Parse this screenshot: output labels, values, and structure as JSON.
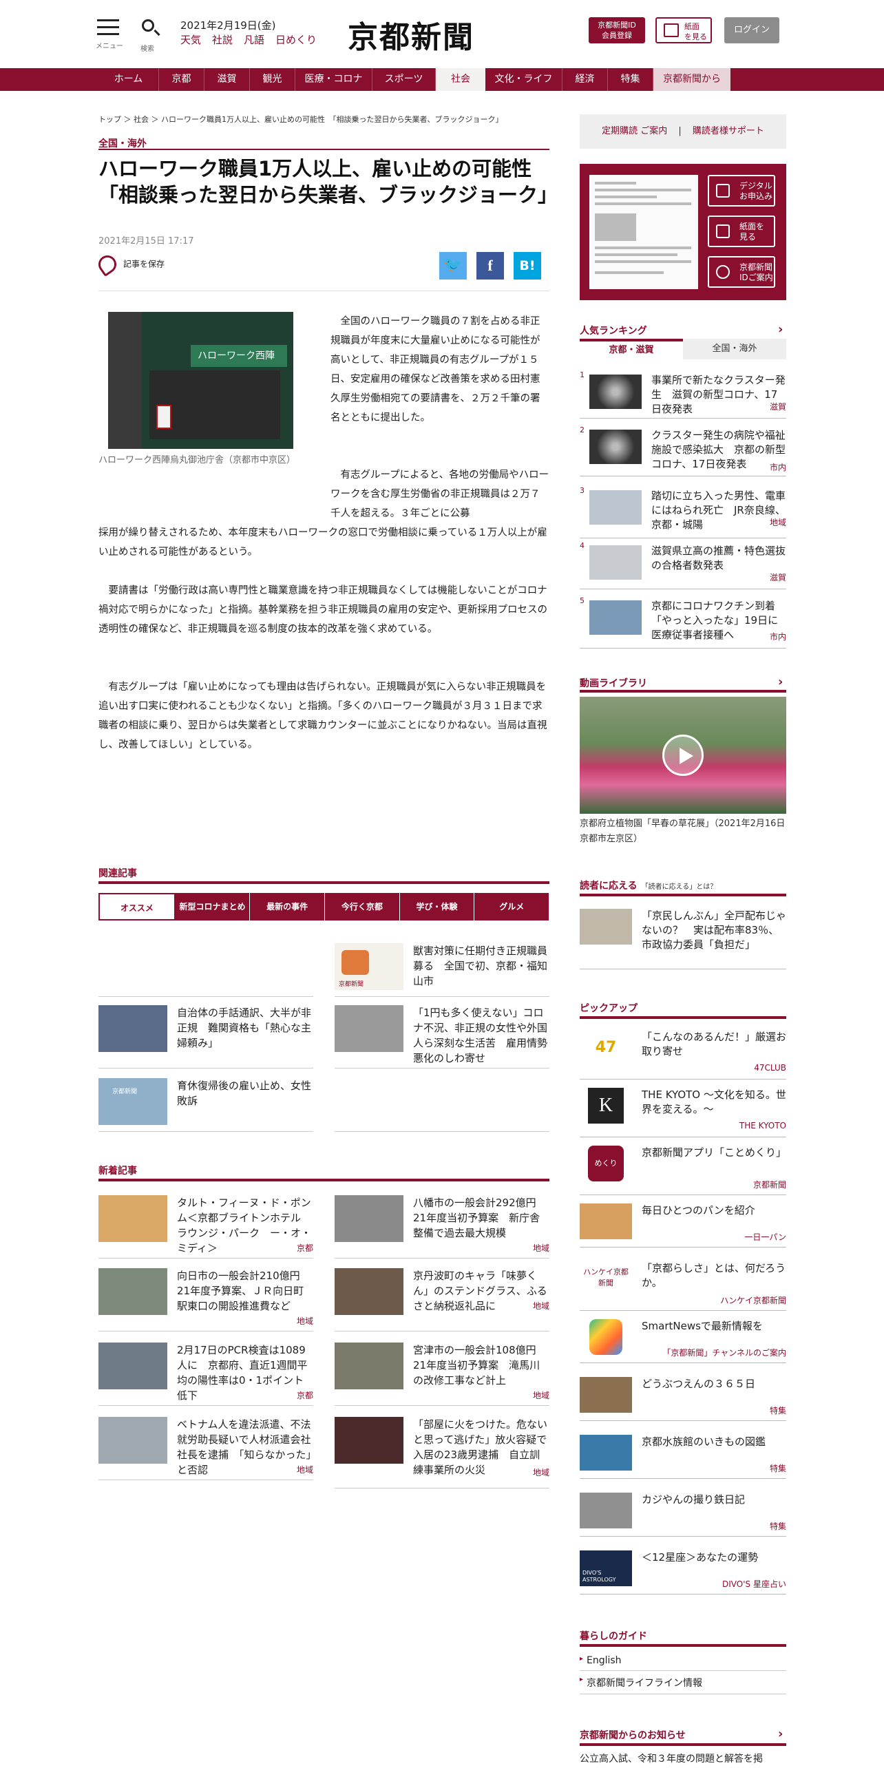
{
  "header": {
    "menu_label": "メニュー",
    "search_label": "検索",
    "date": "2021年2月19日(金)",
    "links": [
      "天気",
      "社説",
      "凡語",
      "日めくり"
    ],
    "logo": "京都新聞",
    "id_button": [
      "京都新聞ID",
      "会員登録"
    ],
    "paper_button": [
      "紙面",
      "を見る"
    ],
    "login_button": "ログイン"
  },
  "nav": [
    "ホーム",
    "京都",
    "滋賀",
    "観光",
    "医療・コロナ",
    "スポーツ",
    "社会",
    "文化・ライフ",
    "経済",
    "特集",
    "京都新聞から"
  ],
  "article": {
    "breadcrumb": "トップ ＞ 社会 ＞ ハローワーク職員1万人以上、雇い止めの可能性　「相談乗った翌日から失業者、ブラックジョーク」",
    "category": "全国・海外",
    "title": "ハローワーク職員1万人以上、雇い止めの可能性　「相談乗った翌日から失業者、ブラックジョーク」",
    "date": "2021年2月15日 17:17",
    "save_label": "記事を保存",
    "photo_sign": "ハローワーク西陣",
    "caption": "ハローワーク西陣烏丸御池庁舎（京都市中京区）",
    "p1": "全国のハローワーク職員の７割を占める非正規職員が年度末に大量雇い止めになる可能性が高いとして、非正規職員の有志グループが１５日、安定雇用の確保など改善策を求める田村憲久厚生労働相宛ての要請書を、２万２千筆の署名とともに提出した。",
    "p2a": "有志グループによると、各地の労働局やハローワークを含む厚生労働省の非正規職員は２万７千人を超える。３年ごとに公募",
    "p2b": "採用が繰り替えされるため、本年度末もハローワークの窓口で労働相談に乗っている１万人以上が雇い止めされる可能性があるという。",
    "p3": "要請書は「労働行政は高い専門性と職業意識を持つ非正規職員なくしては機能しないことがコロナ禍対応で明らかになった」と指摘。基幹業務を担う非正規職員の雇用の安定や、更新採用プロセスの透明性の確保など、非正規職員を巡る制度の抜本的改革を強く求めている。",
    "p4": "有志グループは「雇い止めになっても理由は告げられない。正規職員が気に入らない非正規職員を追い出す口実に使われることも少なくない」と指摘。「多くのハローワーク職員が３月３１日まで求職者の相談に乗り、翌日からは失業者として求職カウンターに並ぶことになりかねない。当局は直視し、改善してほしい」としている。"
  },
  "related": {
    "heading": "関連記事",
    "tabs": [
      "オススメ",
      "新型コロナまとめ",
      "最新の事件",
      "今行く京都",
      "学び・体験",
      "グルメ"
    ],
    "items": [
      {
        "title": "獣害対策に任期付き正規職員募る　全国で初、京都・福知山市"
      },
      {
        "title": "自治体の手話通訳、大半が非正規　難関資格も「熱心な主婦頼み」"
      },
      {
        "title": "「1円も多く使えない」コロナ不況、非正規の女性や外国人ら深刻な生活苦　雇用情勢悪化のしわ寄せ"
      },
      {
        "title": "育休復帰後の雇い止め、女性敗訴"
      }
    ],
    "thumb_label": "京都新聞"
  },
  "latest": {
    "heading": "新着記事",
    "items": [
      {
        "title": "タルト・フィーヌ・ド・ポンム＜京都ブライトンホテル　ラウンジ・パーク　ー・オ・ミディ＞",
        "tag": "京都"
      },
      {
        "title": "八幡市の一般会計292億円　21年度当初予算案　新庁舎整備で過去最大規模",
        "tag": "地域"
      },
      {
        "title": "向日市の一般会計210億円　21年度予算案、ＪＲ向日町駅東口の開設推進費など",
        "tag": "地域"
      },
      {
        "title": "京丹波町のキャラ「味夢くん」のステンドグラス、ふるさと納税返礼品に",
        "tag": "地域"
      },
      {
        "title": "2月17日のPCR検査は1089人に　京都府、直近1週間平均の陽性率は0・1ポイント低下",
        "tag": "京都"
      },
      {
        "title": "宮津市の一般会計108億円　21年度当初予算案　滝馬川の改修工事など計上",
        "tag": "地域"
      },
      {
        "title": "ベトナム人を違法派遣、不法就労助長疑いで人材派遣会社社長を逮捕　「知らなかった」と否認",
        "tag": "地域"
      },
      {
        "title": "「部屋に火をつけた。危ないと思って逃げた」放火容疑で入居の23歳男逮捕　自立訓練事業所の火災",
        "tag": "地域"
      }
    ]
  },
  "sidebar": {
    "subscribe": [
      "定期購読 ご案内",
      "|",
      "購読者様サポート"
    ],
    "paper_buttons": [
      [
        "デジタル",
        "お申込み"
      ],
      [
        "紙面を",
        "見る"
      ],
      [
        "京都新聞",
        "IDご案内"
      ]
    ],
    "ranking": {
      "heading": "人気ランキング",
      "tabs": [
        "京都・滋賀",
        "全国・海外"
      ],
      "items": [
        {
          "n": "1",
          "title": "事業所で新たなクラスター発生　滋賀の新型コロナ、17日夜発表",
          "tag": "滋賀"
        },
        {
          "n": "2",
          "title": "クラスター発生の病院や福祉施設で感染拡大　京都の新型コロナ、17日夜発表",
          "tag": "市内"
        },
        {
          "n": "3",
          "title": "踏切に立ち入った男性、電車にはねられ死亡　JR奈良線、京都・城陽",
          "tag": "地域"
        },
        {
          "n": "4",
          "title": "滋賀県立高の推薦・特色選抜の合格者数発表",
          "tag": "滋賀"
        },
        {
          "n": "5",
          "title": "京都にコロナワクチン到着　「やっと入ったな」19日に医療従事者接種へ",
          "tag": "市内"
        }
      ]
    },
    "video": {
      "heading": "動画ライブラリ",
      "caption": "京都府立植物園「早春の草花展」（2021年2月16日　京都市左京区）"
    },
    "readers": {
      "heading": "読者に応える",
      "sub": "「読者に応える」とは？",
      "title": "「京民しんぶん」全戸配布じゃないの？　実は配布率83％、市政協力委員「負担だ」"
    },
    "pickup": {
      "heading": "ピックアップ",
      "items": [
        {
          "title": "「こんなのあるんだ！」厳選お取り寄せ",
          "tag": "47CLUB",
          "thumb": "47"
        },
        {
          "title": "THE KYOTO ～文化を知る。世界を変える。～",
          "tag": "THE KYOTO",
          "thumb": "K"
        },
        {
          "title": "京都新聞アプリ「ことめくり」",
          "tag": "京都新聞",
          "thumb": "めくり"
        },
        {
          "title": "毎日ひとつのパンを紹介",
          "tag": "一日一パン",
          "thumb": ""
        },
        {
          "title": "「京都らしさ」とは、何だろうか。",
          "tag": "ハンケイ京都新聞",
          "thumb": "ハンケイ京都新聞"
        },
        {
          "title": "SmartNewsで最新情報を",
          "tag": "「京都新聞」チャンネルのご案内",
          "thumb": ""
        },
        {
          "title": "どうぶつえんの３６５日",
          "tag": "特集",
          "thumb": ""
        },
        {
          "title": "京都水族館のいきもの図鑑",
          "tag": "特集",
          "thumb": ""
        },
        {
          "title": "カジやんの撮り鉄日記",
          "tag": "特集",
          "thumb": ""
        },
        {
          "title": "＜12星座＞あなたの運勢",
          "tag": "DIVO'S 星座占い",
          "thumb": "DIVO'S ASTROLOGY"
        }
      ]
    },
    "guide": {
      "heading": "暮らしのガイド",
      "items": [
        "English",
        "京都新聞ライフライン情報"
      ]
    },
    "notice": {
      "heading": "京都新聞からのお知らせ",
      "item": "公立高入試、令和３年度の問題と解答を掲"
    }
  },
  "colors": {
    "brand": "#8a0e2e",
    "twitter": "#55acee",
    "facebook": "#3b5998",
    "hatena": "#00a4de"
  }
}
